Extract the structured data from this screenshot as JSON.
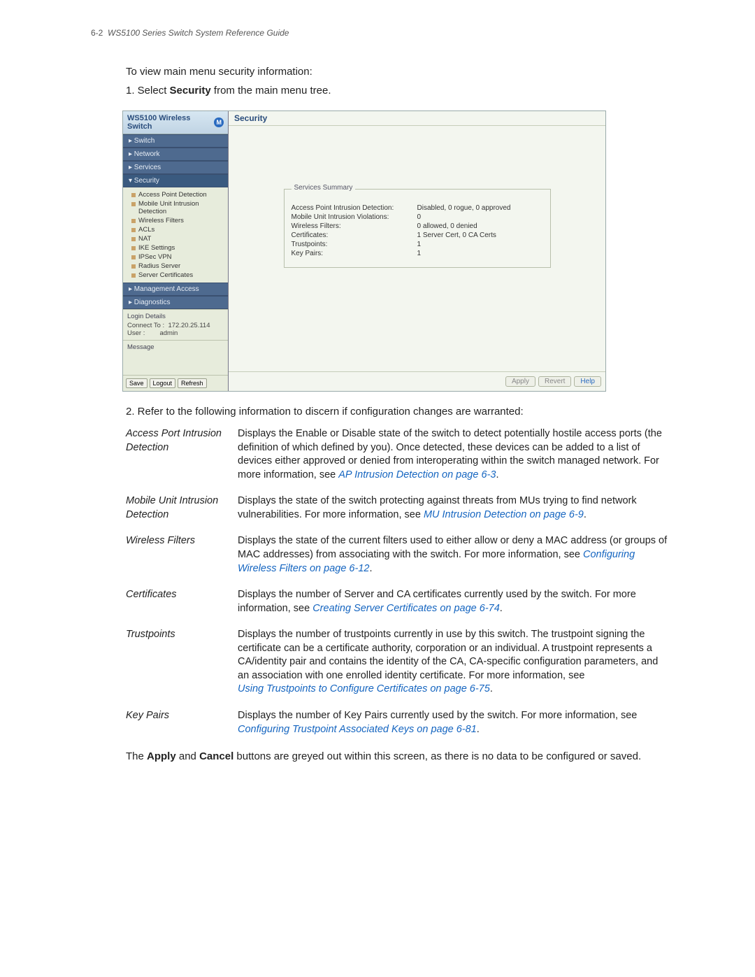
{
  "header": {
    "pagenum": "6-2",
    "title": "WS5100 Series Switch System Reference Guide"
  },
  "intro": "To view main menu security information:",
  "step1_prefix": "1. Select ",
  "step1_bold": "Security",
  "step1_suffix": " from the main menu tree.",
  "app": {
    "title_prefix": "WS5100",
    "title_suffix": " Wireless Switch",
    "badge": "M",
    "nav": {
      "switch": "▸  Switch",
      "network": "▸  Network",
      "services": "▸  Services",
      "security": "▾  Security",
      "mgmt": "▸  Management Access",
      "diag": "▸  Diagnostics"
    },
    "tree": {
      "apd": "Access Point Detection",
      "muid": "Mobile Unit Intrusion Detection",
      "wf": "Wireless Filters",
      "acls": "ACLs",
      "nat": "NAT",
      "ike": "IKE Settings",
      "ipsec": "IPSec VPN",
      "radius": "Radius Server",
      "certs": "Server Certificates"
    },
    "login": {
      "legend": "Login Details",
      "connect_label": "Connect To :",
      "connect_value": "172.20.25.114",
      "user_label": "User :",
      "user_value": "admin"
    },
    "message_legend": "Message",
    "btns": {
      "save": "Save",
      "logout": "Logout",
      "refresh": "Refresh"
    },
    "main_title": "Security",
    "summary": {
      "legend": "Services Summary",
      "rows": [
        {
          "lab": "Access Point Intrusion Detection:",
          "val": "Disabled, 0 rogue, 0 approved"
        },
        {
          "lab": "Mobile Unit Intrusion Violations:",
          "val": "0"
        },
        {
          "lab": "Wireless Filters:",
          "val": "0 allowed, 0 denied"
        },
        {
          "lab": "Certificates:",
          "val": "1 Server Cert, 0 CA Certs"
        },
        {
          "lab": "Trustpoints:",
          "val": "1"
        },
        {
          "lab": "Key Pairs:",
          "val": "1"
        }
      ]
    },
    "footer_btns": {
      "apply": "Apply",
      "revert": "Revert",
      "help": "Help"
    }
  },
  "step2": "2. Refer to the following information to discern if configuration changes are warranted:",
  "defs": [
    {
      "term": "Access Port Intrusion Detection",
      "desc": "Displays the Enable or Disable state of the switch to detect potentially hostile access ports (the definition of which defined by you). Once detected, these devices can be added to a list of devices either approved or denied from interoperating within the switch managed network. For more information, see ",
      "link": "AP Intrusion Detection on page 6-3",
      "tail": "."
    },
    {
      "term": "Mobile Unit Intrusion Detection",
      "desc": "Displays the state of the switch protecting against threats from MUs trying to find network vulnerabilities. For more information, see ",
      "link": "MU Intrusion Detection on page 6-9",
      "tail": "."
    },
    {
      "term": "Wireless Filters",
      "desc": "Displays the state of the current filters used to either allow or deny a MAC address (or groups of MAC addresses) from associating with the switch. For more information, see ",
      "link": "Configuring Wireless Filters on page 6-12",
      "tail": "."
    },
    {
      "term": "Certificates",
      "desc": "Displays the number of Server and CA certificates currently used by the switch. For more information, see ",
      "link": "Creating Server Certificates on page 6-74",
      "tail": "."
    },
    {
      "term": "Trustpoints",
      "desc": "Displays the number of trustpoints currently in use by this switch. The trustpoint signing the certificate can be a certificate authority, corporation or an individual. A trustpoint represents a CA/identity pair and contains the identity of the CA, CA-specific configuration parameters, and an association with one enrolled identity certificate. For more information, see",
      "link": "Using Trustpoints to Configure Certificates on page 6-75",
      "tail": "."
    },
    {
      "term": "Key Pairs",
      "desc": "Displays the number of Key Pairs currently used by the switch. For more information, see ",
      "link": "Configuring Trustpoint Associated Keys on page 6-81",
      "tail": "."
    }
  ],
  "note": {
    "pre": "The ",
    "b1": "Apply",
    "mid": " and ",
    "b2": "Cancel",
    "post": " buttons are greyed out within this screen, as there is no data to be configured or saved."
  }
}
